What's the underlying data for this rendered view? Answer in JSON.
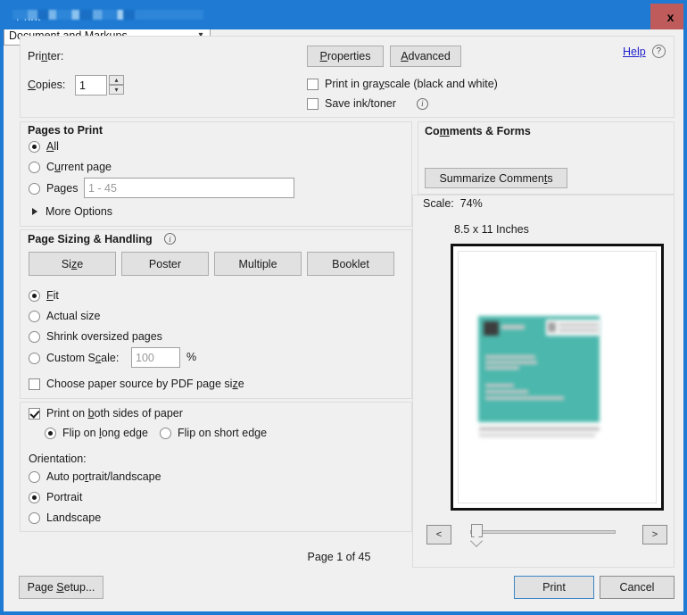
{
  "window": {
    "title": "Print",
    "close_label": "x"
  },
  "printer": {
    "label": "Printer:",
    "label_mnemonic_pre": "Pri",
    "label_mnemonic": "n",
    "label_mnemonic_post": "ter:",
    "value": "",
    "properties_label": "Properties",
    "advanced_label": "Advanced",
    "help_label": "Help",
    "help_icon": "question-circle-icon",
    "dropdown_icon": "chevron-down-icon"
  },
  "copies": {
    "label": "Copies:",
    "value": "1",
    "up_icon": "chevron-up-icon",
    "down_icon": "chevron-down-icon"
  },
  "print_options": [
    {
      "label": "Print in grayscale (black and white)",
      "checked": false,
      "info": false
    },
    {
      "label": "Save ink/toner",
      "checked": false,
      "info": true
    }
  ],
  "pages_to_print": {
    "title": "Pages to Print",
    "options": [
      {
        "label": "All",
        "selected": true
      },
      {
        "label": "Current page",
        "selected": false
      },
      {
        "label": "Pages",
        "selected": false
      }
    ],
    "pages_placeholder": "1 - 45",
    "pages_value": "",
    "more_options_label": "More Options",
    "more_options_icon": "triangle-right-icon"
  },
  "page_sizing": {
    "title": "Page Sizing & Handling",
    "info_icon": "info-icon",
    "buttons": [
      "Size",
      "Poster",
      "Multiple",
      "Booklet"
    ],
    "options": [
      {
        "label": "Fit",
        "selected": true
      },
      {
        "label": "Actual size",
        "selected": false
      },
      {
        "label": "Shrink oversized pages",
        "selected": false
      },
      {
        "label": "Custom Scale:",
        "selected": false
      }
    ],
    "custom_scale_placeholder": "100",
    "custom_scale_value": "",
    "percent_label": "%",
    "paper_source_label": "Choose paper source by PDF page size",
    "paper_source_checked": false
  },
  "duplex": {
    "label": "Print on both sides of paper",
    "checked": true,
    "flip_options": [
      {
        "label": "Flip on long edge",
        "selected": true
      },
      {
        "label": "Flip on short edge",
        "selected": false
      }
    ],
    "orientation_label": "Orientation:",
    "orientation_options": [
      {
        "label": "Auto portrait/landscape",
        "selected": false
      },
      {
        "label": "Portrait",
        "selected": true
      },
      {
        "label": "Landscape",
        "selected": false
      }
    ]
  },
  "comments_forms": {
    "title": "Comments & Forms",
    "selected": "Document and Markups",
    "dropdown_icon": "chevron-down-icon",
    "summarize_label": "Summarize Comments"
  },
  "preview": {
    "scale_label": "Scale:",
    "scale_value": "74%",
    "paper_size": "8.5 x 11 Inches",
    "page_status": "Page 1 of 45",
    "prev_label": "<",
    "next_label": ">",
    "prev_icon": "chevron-left-icon",
    "next_icon": "chevron-right-icon",
    "slider_icon": "slider-thumb-handle",
    "card_color": "#4cb8ad"
  },
  "footer": {
    "page_setup_label": "Page Setup...",
    "print_label": "Print",
    "cancel_label": "Cancel"
  },
  "colors": {
    "accent": "#1e7ad2",
    "close": "#bf5b5b",
    "link": "#2222cc",
    "dialog_bg": "#f0f0f0",
    "teal": "#4cb8ad"
  }
}
